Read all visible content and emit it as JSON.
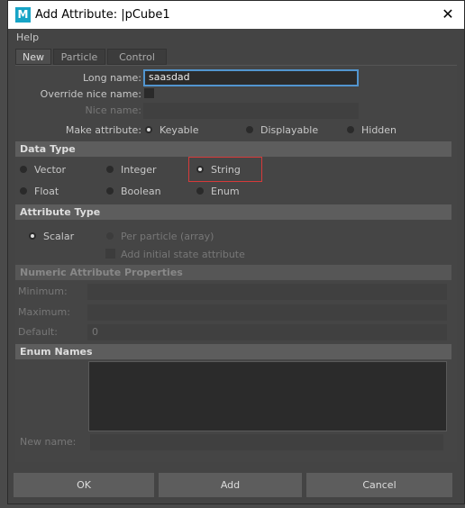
{
  "window": {
    "title": "Add Attribute: |pCube1",
    "close_glyph": "✕",
    "app_icon": "M"
  },
  "menu": [
    "Help"
  ],
  "tabs": [
    {
      "label": "New",
      "active": true
    },
    {
      "label": "Particle",
      "active": false
    },
    {
      "label": "Control",
      "active": false
    }
  ],
  "form": {
    "long_name_label": "Long name:",
    "long_name_value": "saasdad",
    "override_label": "Override nice name:",
    "nice_name_label": "Nice name:",
    "make_attr_label": "Make attribute:",
    "make_attr_options": [
      "Keyable",
      "Displayable",
      "Hidden"
    ],
    "make_attr_selected": "Keyable"
  },
  "data_type": {
    "header": "Data Type",
    "options": [
      "Vector",
      "Integer",
      "String",
      "Float",
      "Boolean",
      "Enum"
    ],
    "selected": "String"
  },
  "attribute_type": {
    "header": "Attribute Type",
    "scalar": "Scalar",
    "per_particle": "Per particle (array)",
    "add_initial": "Add initial state attribute"
  },
  "numeric": {
    "header": "Numeric Attribute Properties",
    "minimum": "Minimum:",
    "maximum": "Maximum:",
    "default": "Default:",
    "default_value": "0"
  },
  "enum": {
    "header": "Enum Names",
    "new_name_label": "New name:"
  },
  "buttons": {
    "ok": "OK",
    "add": "Add",
    "cancel": "Cancel"
  },
  "colors": {
    "accent": "#5295cf",
    "highlight": "#d63a3a",
    "header": "#5d5d5d"
  }
}
